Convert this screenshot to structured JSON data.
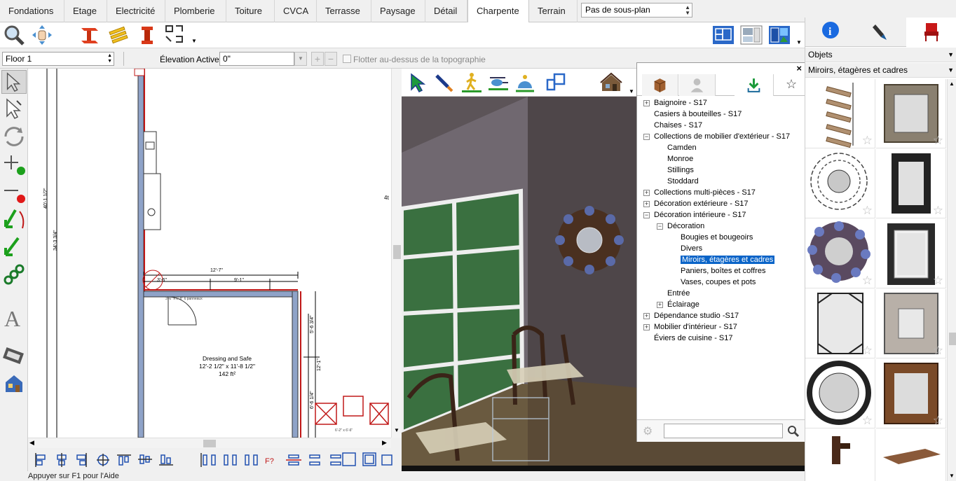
{
  "tabs": [
    "Fondations",
    "Etage",
    "Electricité",
    "Plomberie",
    "Toiture",
    "CVCA",
    "Terrasse",
    "Paysage",
    "Détail",
    "Charpente",
    "Terrain"
  ],
  "active_tab": "Charpente",
  "plan_select": "Pas de sous-plan",
  "toolbar2": {
    "floor": "Floor 1",
    "elevation_label": "Élevation Active:",
    "elevation_value": "0\"",
    "float_label": "Flotter au-dessus de la topographie"
  },
  "plan": {
    "room_name": "Dressing and Safe",
    "room_dims": "12'-2 1/2\" x 11'-8 1/2\"",
    "room_area": "142 ft²",
    "dim_top": "12'-7\"",
    "dim_left_a": "3'-6\"",
    "dim_left_b": "9'-1\"",
    "dim_vert_a": "40'-1 1/2\"",
    "dim_vert_b": "34'-3 3/4\"",
    "dim_right_a": "5'-6 3/4\"",
    "dim_right_b": "12'-1\"",
    "dim_right_c": "6'-6 1/4\"",
    "dim_edge": "4t",
    "door_note": "3'-6\" x 6'-8\" 6 panneaux",
    "dim_bottom": "6'-2\" x 6'-6\""
  },
  "library": {
    "tree": [
      {
        "label": "Baignoire - S17",
        "level": 0,
        "exp": "+"
      },
      {
        "label": "Casiers à bouteilles - S17",
        "level": 0,
        "exp": ""
      },
      {
        "label": "Chaises - S17",
        "level": 0,
        "exp": ""
      },
      {
        "label": "Collections de mobilier d'extérieur - S17",
        "level": 0,
        "exp": "-"
      },
      {
        "label": "Camden",
        "level": 1,
        "exp": ""
      },
      {
        "label": "Monroe",
        "level": 1,
        "exp": ""
      },
      {
        "label": "Stillings",
        "level": 1,
        "exp": ""
      },
      {
        "label": "Stoddard",
        "level": 1,
        "exp": ""
      },
      {
        "label": "Collections multi-pièces - S17",
        "level": 0,
        "exp": "+"
      },
      {
        "label": "Décoration extérieure - S17",
        "level": 0,
        "exp": "+"
      },
      {
        "label": "Décoration intérieure - S17",
        "level": 0,
        "exp": "-"
      },
      {
        "label": "Décoration",
        "level": 1,
        "exp": "-"
      },
      {
        "label": "Bougies et bougeoirs",
        "level": 2,
        "exp": ""
      },
      {
        "label": "Divers",
        "level": 2,
        "exp": ""
      },
      {
        "label": "Miroirs, étagères et cadres",
        "level": 2,
        "exp": "",
        "selected": true
      },
      {
        "label": "Paniers, boîtes et coffres",
        "level": 2,
        "exp": ""
      },
      {
        "label": "Vases, coupes et pots",
        "level": 2,
        "exp": ""
      },
      {
        "label": "Entrée",
        "level": 1,
        "exp": ""
      },
      {
        "label": "Éclairage",
        "level": 1,
        "exp": "+"
      },
      {
        "label": "Dépendance studio -S17",
        "level": 0,
        "exp": "+"
      },
      {
        "label": "Mobilier d'intérieur - S17",
        "level": 0,
        "exp": "+"
      },
      {
        "label": "Éviers de cuisine - S17",
        "level": 0,
        "exp": ""
      }
    ],
    "search_value": ""
  },
  "right": {
    "dd1": "Objets",
    "dd2": "Miroirs, étagères et cadres",
    "star": "☆"
  },
  "status": "Appuyer sur F1 pour l'Aide",
  "colors": {
    "accent": "#0a64c8",
    "wall_red": "#c01818",
    "wall_blue": "#8fa3c8"
  }
}
